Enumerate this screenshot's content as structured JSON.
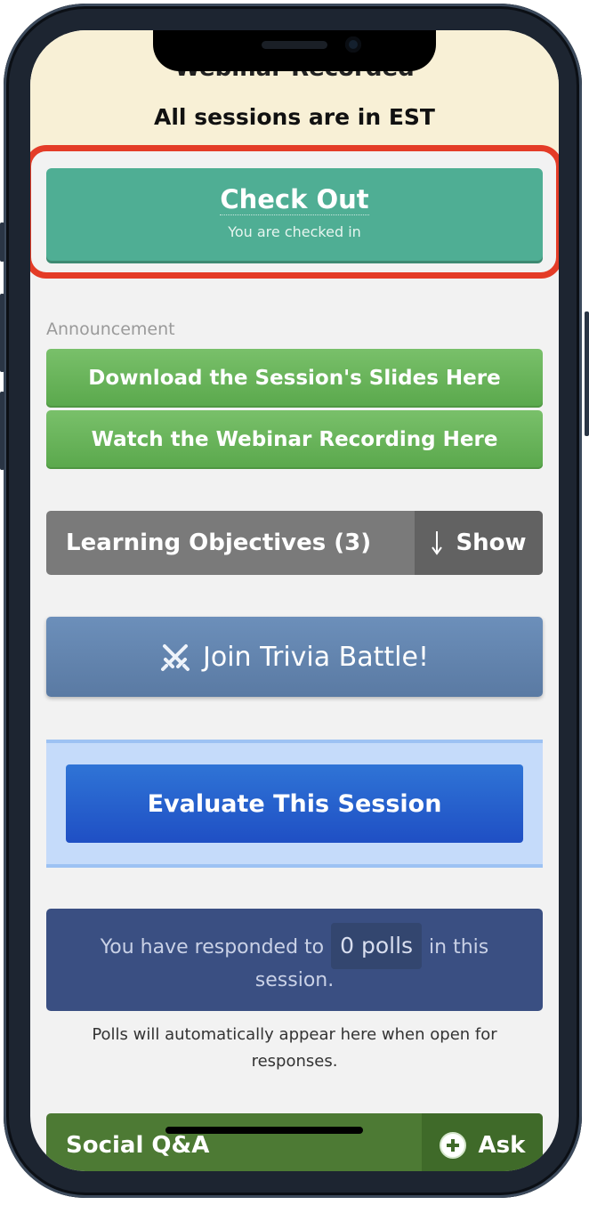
{
  "banner": {
    "clipped_title": "Webinar Recorded",
    "timezone_notice": "All sessions are in EST"
  },
  "checkout": {
    "title": "Check Out",
    "subtitle": "You are checked in"
  },
  "announcement": {
    "label": "Announcement",
    "buttons": [
      "Download the Session's Slides Here",
      "Watch the Webinar Recording Here"
    ]
  },
  "learning_objectives": {
    "title": "Learning Objectives (3)",
    "toggle_label": "Show",
    "toggle_icon": "arrow-down-icon"
  },
  "trivia": {
    "label": "Join Trivia Battle!",
    "icon": "crossed-swords-icon"
  },
  "evaluate": {
    "label": "Evaluate This Session"
  },
  "polls": {
    "prefix": "You have responded to",
    "count": "0 polls",
    "suffix": "in this",
    "line2": "session.",
    "note": "Polls will automatically appear here when open for responses."
  },
  "social": {
    "title": "Social Q&A",
    "ask_label": "Ask",
    "ask_icon": "plus-circle-icon"
  },
  "colors": {
    "checkout_bg": "#4fae94",
    "highlight_border": "#e43c27",
    "announcement_green": "#6ab55c",
    "trivia_blue": "#6384b0",
    "evaluate_blue": "#2a62d0",
    "polls_bg": "#3a4f82",
    "social_green": "#4d7a34"
  }
}
